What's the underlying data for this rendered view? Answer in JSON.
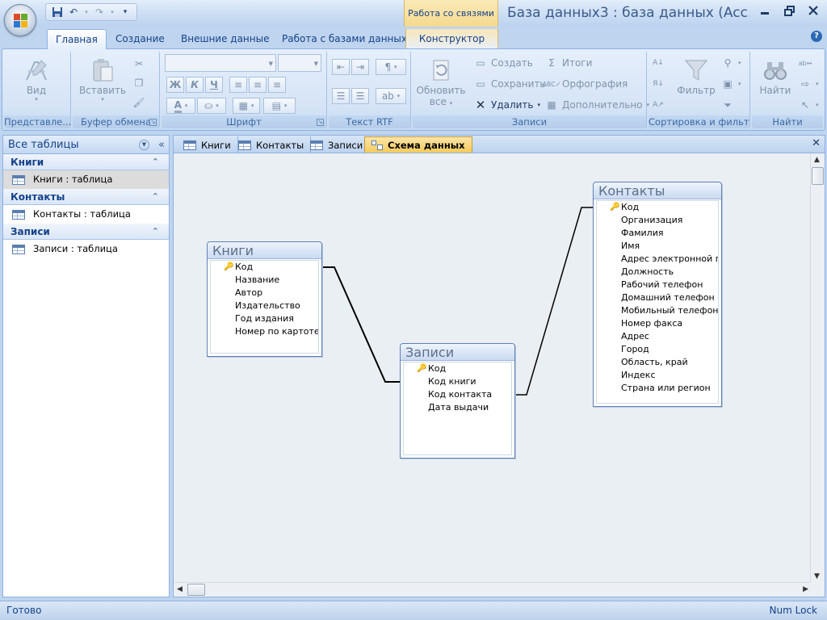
{
  "app": {
    "window_title": "База данных3 : база данных (Acc...",
    "context_group": "Работа со связями",
    "help_label": "?",
    "window_controls": [
      "minimize-icon",
      "restore-icon",
      "close-icon"
    ]
  },
  "ribbon_tabs": [
    "Главная",
    "Создание",
    "Внешние данные",
    "Работа с базами данных",
    "Конструктор"
  ],
  "ribbon": {
    "groups": {
      "views": "Представле...",
      "clipboard": "Буфер обмена",
      "font": "Шрифт",
      "rtf": "Текст RTF",
      "records": "Записи",
      "sort": "Сортировка и фильтр",
      "find": "Найти"
    },
    "buttons": {
      "view": "Вид",
      "paste": "Вставить",
      "refresh": "Обновить",
      "refresh_sub": "все",
      "create": "Создать",
      "save": "Сохранить",
      "delete": "Удалить",
      "totals": "Итоги",
      "spelling": "Орфография",
      "more": "Дополнительно",
      "filter": "Фильтр",
      "find": "Найти",
      "bold": "Ж",
      "italic": "К",
      "underline": "Ч"
    }
  },
  "nav": {
    "header": "Все таблицы",
    "groups": [
      {
        "title": "Книги",
        "item": "Книги : таблица",
        "selected": true
      },
      {
        "title": "Контакты",
        "item": "Контакты : таблица",
        "selected": false
      },
      {
        "title": "Записи",
        "item": "Записи : таблица",
        "selected": false
      }
    ]
  },
  "doc_tabs": [
    "Книги",
    "Контакты",
    "Записи",
    "Схема данных"
  ],
  "active_doc_tab": "Схема данных",
  "tables": {
    "books": {
      "title": "Книги",
      "fields": [
        "Код",
        "Название",
        "Автор",
        "Издательство",
        "Год издания",
        "Номер по картотек"
      ]
    },
    "records": {
      "title": "Записи",
      "fields": [
        "Код",
        "Код книги",
        "Код контакта",
        "Дата выдачи"
      ]
    },
    "contacts": {
      "title": "Контакты",
      "fields": [
        "Код",
        "Организация",
        "Фамилия",
        "Имя",
        "Адрес электронной по",
        "Должность",
        "Рабочий телефон",
        "Домашний телефон",
        "Мобильный телефон",
        "Номер факса",
        "Адрес",
        "Город",
        "Область, край",
        "Индекс",
        "Страна или регион"
      ]
    }
  },
  "relationships": [
    {
      "from_table": "Книги",
      "from_field": "Код",
      "to_table": "Записи",
      "to_field": "Код книги"
    },
    {
      "from_table": "Записи",
      "from_field": "Код контакта",
      "to_table": "Контакты",
      "to_field": "Код"
    }
  ],
  "status": {
    "left": "Готово",
    "right": "Num Lock"
  }
}
